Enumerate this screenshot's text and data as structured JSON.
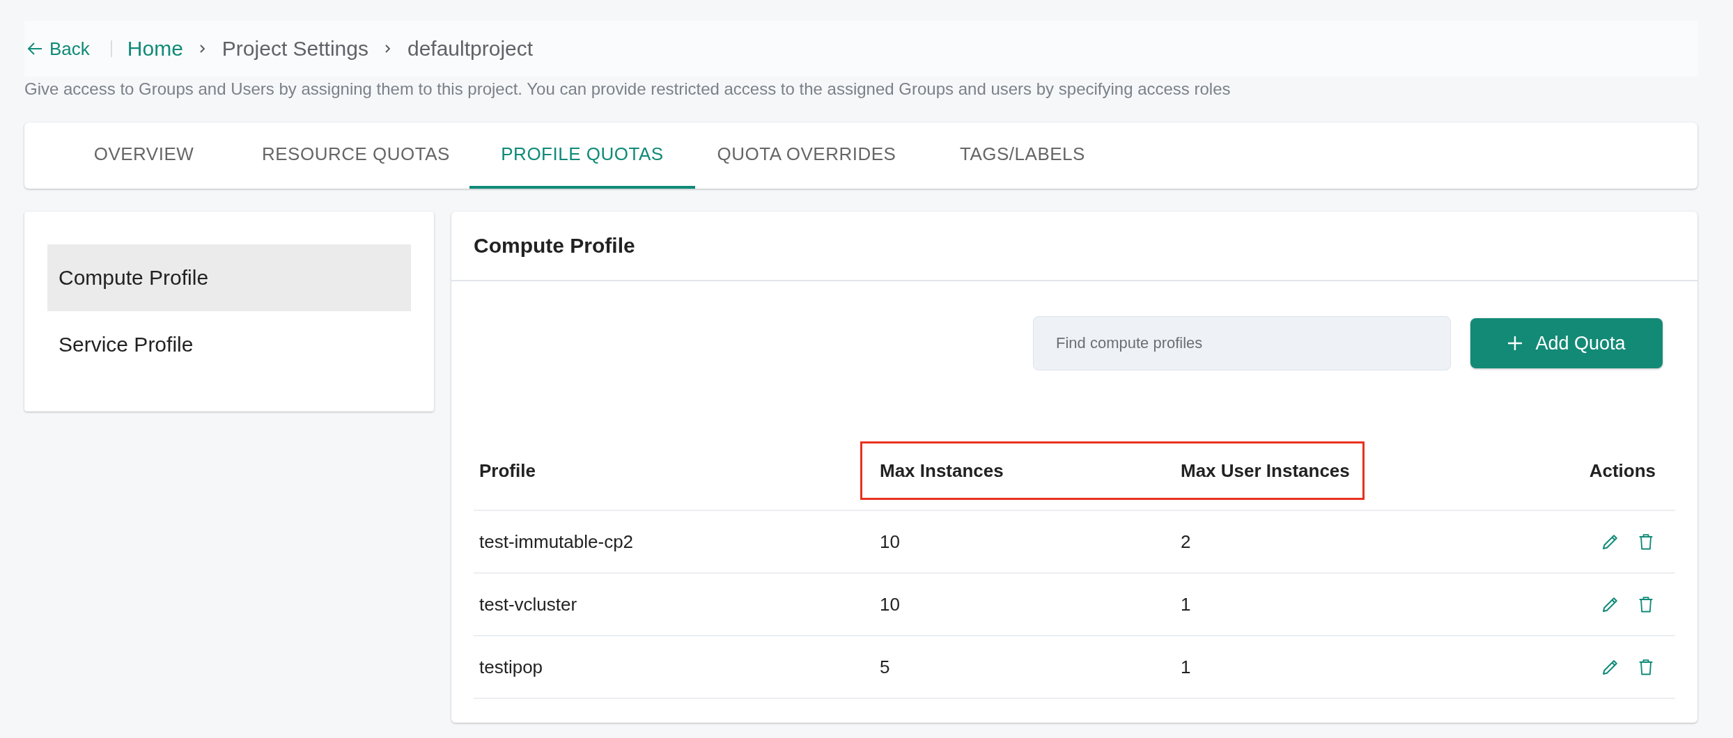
{
  "breadcrumb": {
    "back": "Back",
    "items": [
      {
        "label": "Home",
        "link": true
      },
      {
        "label": "Project Settings",
        "link": false
      },
      {
        "label": "defaultproject",
        "link": false
      }
    ]
  },
  "description": "Give access to Groups and Users by assigning them to this project. You can provide restricted access to the assigned Groups and users by specifying access roles",
  "tabs": [
    {
      "label": "OVERVIEW",
      "selected": false
    },
    {
      "label": "RESOURCE QUOTAS",
      "selected": false
    },
    {
      "label": "PROFILE QUOTAS",
      "selected": true
    },
    {
      "label": "QUOTA OVERRIDES",
      "selected": false
    },
    {
      "label": "TAGS/LABELS",
      "selected": false
    }
  ],
  "sidebar": {
    "items": [
      {
        "label": "Compute Profile",
        "selected": true
      },
      {
        "label": "Service Profile",
        "selected": false
      }
    ]
  },
  "panel": {
    "title": "Compute Profile",
    "search": {
      "placeholder": "Find compute profiles"
    },
    "add_button": "Add Quota",
    "table": {
      "columns": [
        {
          "label": "Profile",
          "highlighted": false
        },
        {
          "label": "Max Instances",
          "highlighted": true
        },
        {
          "label": "Max User Instances",
          "highlighted": true
        },
        {
          "label": "Actions",
          "highlighted": false
        }
      ],
      "rows": [
        {
          "profile": "test-immutable-cp2",
          "max_instances": "10",
          "max_user_instances": "2"
        },
        {
          "profile": "test-vcluster",
          "max_instances": "10",
          "max_user_instances": "1"
        },
        {
          "profile": "testipop",
          "max_instances": "5",
          "max_user_instances": "1"
        }
      ]
    }
  }
}
